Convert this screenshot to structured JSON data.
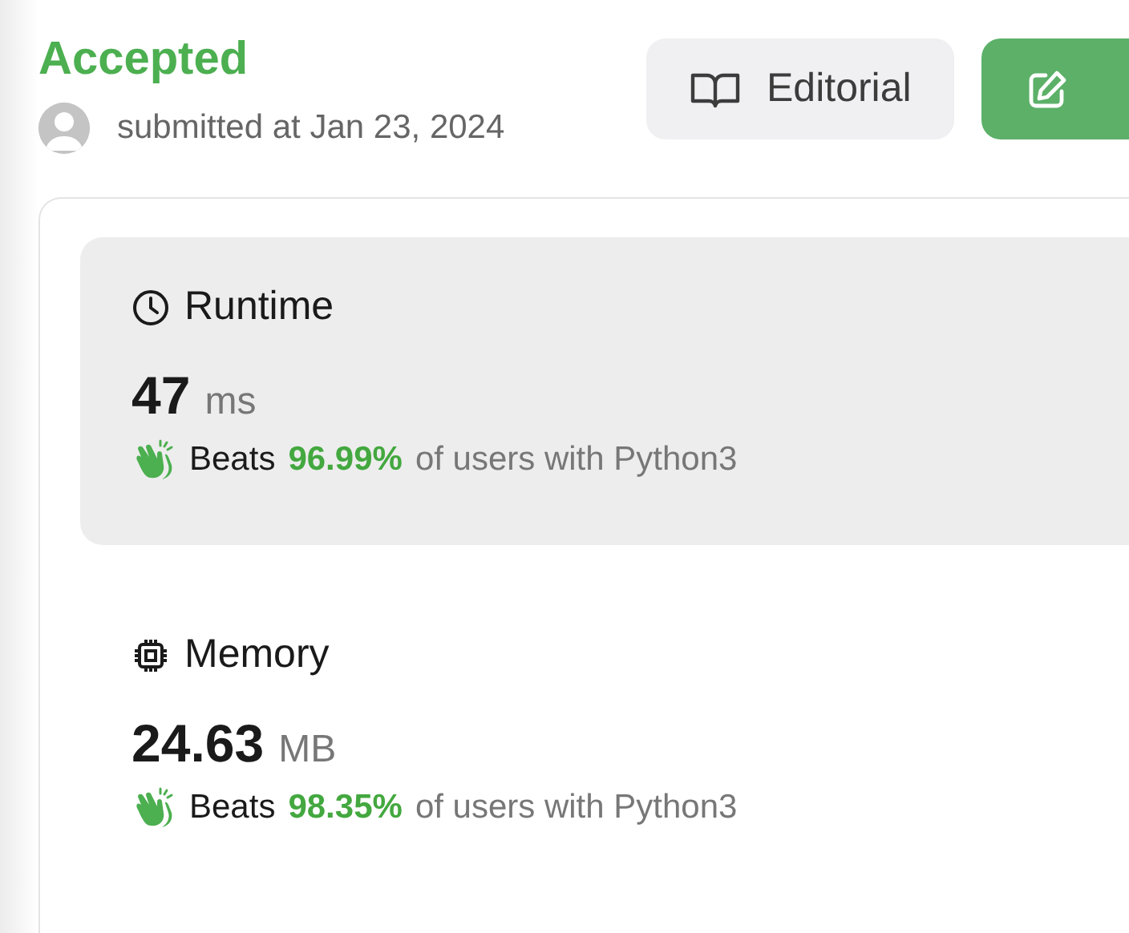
{
  "status": "Accepted",
  "submission": {
    "text": "submitted at Jan 23, 2024"
  },
  "buttons": [
    {
      "kind": "editorial",
      "label": "Editorial"
    },
    {
      "kind": "edit"
    }
  ],
  "metrics": [
    {
      "kind": "runtime",
      "title": "Runtime",
      "highlighted": true,
      "value": "47",
      "unit": "ms",
      "beats": "Beats",
      "percentile": "96.99%",
      "comparison": "of users with Python3"
    },
    {
      "kind": "memory",
      "title": "Memory",
      "highlighted": false,
      "value": "24.63",
      "unit": "MB",
      "beats": "Beats",
      "percentile": "98.35%",
      "comparison": "of users with Python3"
    }
  ]
}
